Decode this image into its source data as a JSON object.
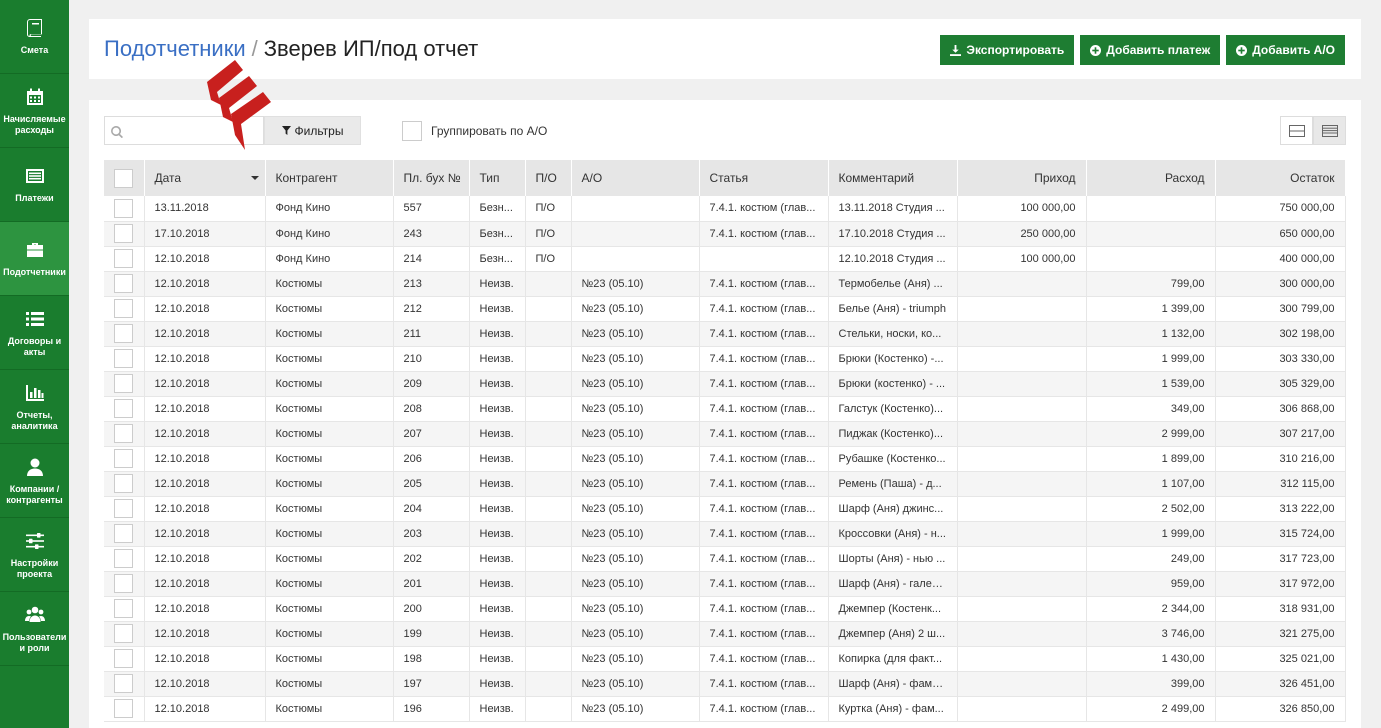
{
  "sidebar": {
    "items": [
      {
        "label": "Смета",
        "icon": "book-icon"
      },
      {
        "label": "Начисляемые расходы",
        "icon": "calendar-icon"
      },
      {
        "label": "Платежи",
        "icon": "list-icon"
      },
      {
        "label": "Подотчетники",
        "icon": "briefcase-icon"
      },
      {
        "label": "Договоры и акты",
        "icon": "menu-list-icon"
      },
      {
        "label": "Отчеты, аналитика",
        "icon": "bar-chart-icon"
      },
      {
        "label": "Компании / контрагенты",
        "icon": "user-icon"
      },
      {
        "label": "Настройки проекта",
        "icon": "sliders-icon"
      },
      {
        "label": "Пользователи и роли",
        "icon": "users-icon"
      }
    ]
  },
  "header": {
    "crumb": "Подотчетники",
    "separator": "/",
    "current": "Зверев ИП/под отчет",
    "buttons": {
      "export": "Экспортировать",
      "add_payment": "Добавить платеж",
      "add_ao": "Добавить А/О"
    }
  },
  "toolbar": {
    "search_placeholder": "",
    "filters": "Фильтры",
    "group_by": "Группировать по А/О"
  },
  "table": {
    "columns": [
      "Дата",
      "Контрагент",
      "Пл. бух №",
      "Тип",
      "П/О",
      "А/О",
      "Статья",
      "Комментарий",
      "Приход",
      "Расход",
      "Остаток"
    ],
    "rows": [
      [
        "13.11.2018",
        "Фонд Кино",
        "557",
        "Безн...",
        "П/О",
        "",
        "7.4.1. костюм (глав...",
        "13.11.2018 Студия ...",
        "100 000,00",
        "",
        "750 000,00"
      ],
      [
        "17.10.2018",
        "Фонд Кино",
        "243",
        "Безн...",
        "П/О",
        "",
        "7.4.1. костюм (глав...",
        "17.10.2018 Студия ...",
        "250 000,00",
        "",
        "650 000,00"
      ],
      [
        "12.10.2018",
        "Фонд Кино",
        "214",
        "Безн...",
        "П/О",
        "",
        "",
        "12.10.2018 Студия ...",
        "100 000,00",
        "",
        "400 000,00"
      ],
      [
        "12.10.2018",
        "Костюмы",
        "213",
        "Неизв.",
        "",
        "№23 (05.10)",
        "7.4.1. костюм (глав...",
        "Термобелье (Аня) ...",
        "",
        "799,00",
        "300 000,00"
      ],
      [
        "12.10.2018",
        "Костюмы",
        "212",
        "Неизв.",
        "",
        "№23 (05.10)",
        "7.4.1. костюм (глав...",
        "Белье (Аня) - triumph",
        "",
        "1 399,00",
        "300 799,00"
      ],
      [
        "12.10.2018",
        "Костюмы",
        "211",
        "Неизв.",
        "",
        "№23 (05.10)",
        "7.4.1. костюм (глав...",
        "Стельки, носки, ко...",
        "",
        "1 132,00",
        "302 198,00"
      ],
      [
        "12.10.2018",
        "Костюмы",
        "210",
        "Неизв.",
        "",
        "№23 (05.10)",
        "7.4.1. костюм (глав...",
        "Брюки (Костенко) -...",
        "",
        "1 999,00",
        "303 330,00"
      ],
      [
        "12.10.2018",
        "Костюмы",
        "209",
        "Неизв.",
        "",
        "№23 (05.10)",
        "7.4.1. костюм (глав...",
        "Брюки (костенко) - ...",
        "",
        "1 539,00",
        "305 329,00"
      ],
      [
        "12.10.2018",
        "Костюмы",
        "208",
        "Неизв.",
        "",
        "№23 (05.10)",
        "7.4.1. костюм (глав...",
        "Галстук (Костенко)...",
        "",
        "349,00",
        "306 868,00"
      ],
      [
        "12.10.2018",
        "Костюмы",
        "207",
        "Неизв.",
        "",
        "№23 (05.10)",
        "7.4.1. костюм (глав...",
        "Пиджак (Костенко)...",
        "",
        "2 999,00",
        "307 217,00"
      ],
      [
        "12.10.2018",
        "Костюмы",
        "206",
        "Неизв.",
        "",
        "№23 (05.10)",
        "7.4.1. костюм (глав...",
        "Рубашке (Костенко...",
        "",
        "1 899,00",
        "310 216,00"
      ],
      [
        "12.10.2018",
        "Костюмы",
        "205",
        "Неизв.",
        "",
        "№23 (05.10)",
        "7.4.1. костюм (глав...",
        "Ремень (Паша) - д...",
        "",
        "1 107,00",
        "312 115,00"
      ],
      [
        "12.10.2018",
        "Костюмы",
        "204",
        "Неизв.",
        "",
        "№23 (05.10)",
        "7.4.1. костюм (глав...",
        "Шарф (Аня) джинс...",
        "",
        "2 502,00",
        "313 222,00"
      ],
      [
        "12.10.2018",
        "Костюмы",
        "203",
        "Неизв.",
        "",
        "№23 (05.10)",
        "7.4.1. костюм (глав...",
        "Кроссовки (Аня) - н...",
        "",
        "1 999,00",
        "315 724,00"
      ],
      [
        "12.10.2018",
        "Костюмы",
        "202",
        "Неизв.",
        "",
        "№23 (05.10)",
        "7.4.1. костюм (глав...",
        "Шорты (Аня) - нью ...",
        "",
        "249,00",
        "317 723,00"
      ],
      [
        "12.10.2018",
        "Костюмы",
        "201",
        "Неизв.",
        "",
        "№23 (05.10)",
        "7.4.1. костюм (глав...",
        "Шарф (Аня) - галер...",
        "",
        "959,00",
        "317 972,00"
      ],
      [
        "12.10.2018",
        "Костюмы",
        "200",
        "Неизв.",
        "",
        "№23 (05.10)",
        "7.4.1. костюм (глав...",
        "Джемпер (Костенк...",
        "",
        "2 344,00",
        "318 931,00"
      ],
      [
        "12.10.2018",
        "Костюмы",
        "199",
        "Неизв.",
        "",
        "№23 (05.10)",
        "7.4.1. костюм (глав...",
        "Джемпер (Аня) 2 ш...",
        "",
        "3 746,00",
        "321 275,00"
      ],
      [
        "12.10.2018",
        "Костюмы",
        "198",
        "Неизв.",
        "",
        "№23 (05.10)",
        "7.4.1. костюм (глав...",
        "Копирка (для факт...",
        "",
        "1 430,00",
        "325 021,00"
      ],
      [
        "12.10.2018",
        "Костюмы",
        "197",
        "Неизв.",
        "",
        "№23 (05.10)",
        "7.4.1. костюм (глав...",
        "Шарф (Аня) - фами...",
        "",
        "399,00",
        "326 451,00"
      ],
      [
        "12.10.2018",
        "Костюмы",
        "196",
        "Неизв.",
        "",
        "№23 (05.10)",
        "7.4.1. костюм (глав...",
        "Куртка (Аня) - фам...",
        "",
        "2 499,00",
        "326 850,00"
      ]
    ]
  },
  "colors": {
    "sidebar": "#1a7d2e",
    "sidebar_active": "#2d9440",
    "button_green": "#1e7d32",
    "link_blue": "#3a6fc4",
    "annotation_red": "#c8201e"
  }
}
